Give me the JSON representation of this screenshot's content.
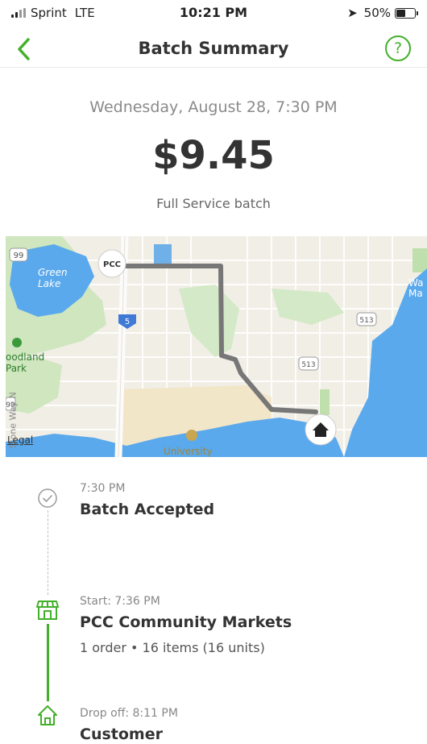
{
  "status_bar": {
    "carrier": "Sprint",
    "network": "LTE",
    "time": "10:21 PM",
    "battery_text": "50%",
    "battery_level": 0.5
  },
  "nav": {
    "title": "Batch Summary",
    "back_icon": "chevron-left-icon",
    "help_icon": "question-circle-icon"
  },
  "summary": {
    "date": "Wednesday, August 28, 7:30 PM",
    "amount": "$9.45",
    "batch_type": "Full Service batch"
  },
  "map": {
    "labels": {
      "green_lake": "Green\nLake",
      "woodland_park": "oodland\nPark",
      "university": "University",
      "wa": "Wa\nMa",
      "street": "Stone Way N"
    },
    "route_shields": [
      "99",
      "5",
      "513",
      "513",
      "99"
    ],
    "store_marker": "PCC",
    "destination_icon": "home-icon",
    "legal": "Legal"
  },
  "timeline": [
    {
      "time": "7:30 PM",
      "title": "Batch Accepted",
      "detail": "",
      "icon": "check-circle-icon"
    },
    {
      "time": "Start: 7:36 PM",
      "title": "PCC Community Markets",
      "detail": "1 order • 16 items (16 units)",
      "icon": "storefront-icon"
    },
    {
      "time": "Drop off: 8:11 PM",
      "title": "Customer",
      "detail": "",
      "icon": "house-icon"
    }
  ],
  "colors": {
    "accent": "#43b02a",
    "route": "#777777",
    "water": "#5aa9ec"
  }
}
